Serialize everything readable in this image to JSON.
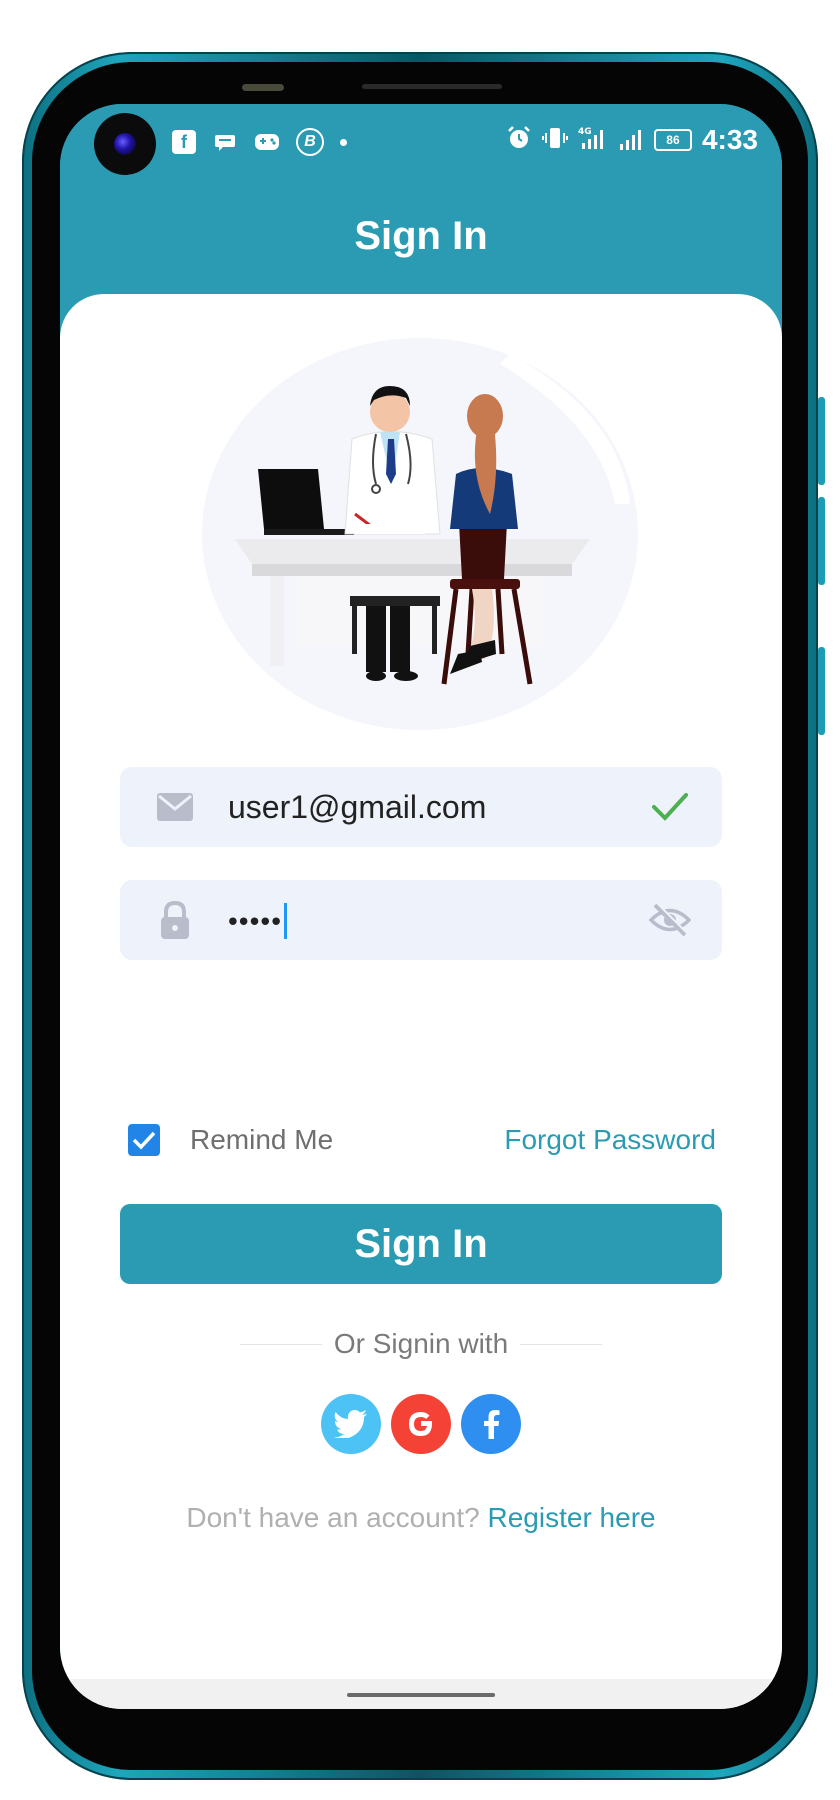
{
  "statusbar": {
    "time": "4:33",
    "battery": "86",
    "network": "4G",
    "notification_icons": [
      "facebook-icon",
      "message-icon",
      "game-icon",
      "bitcoin-icon"
    ]
  },
  "header": {
    "title": "Sign In"
  },
  "form": {
    "email": {
      "value": "user1@gmail.com",
      "valid": true
    },
    "password": {
      "masked_value": "•••••",
      "visibility": "hidden"
    },
    "remember_label": "Remind Me",
    "remember_checked": true,
    "forgot_label": "Forgot Password",
    "submit_label": "Sign In"
  },
  "social": {
    "divider_label": "Or Signin with",
    "providers": [
      {
        "name": "twitter",
        "color": "#4cc2f5"
      },
      {
        "name": "google",
        "color": "#f44336"
      },
      {
        "name": "facebook",
        "color": "#2f8ff0"
      }
    ]
  },
  "footer": {
    "prompt": "Don't have an account?",
    "link": "Register here"
  },
  "colors": {
    "accent": "#2a9bb2",
    "field_bg": "#eef2fb",
    "checkbox": "#2085e6",
    "valid_check": "#4caf50"
  }
}
